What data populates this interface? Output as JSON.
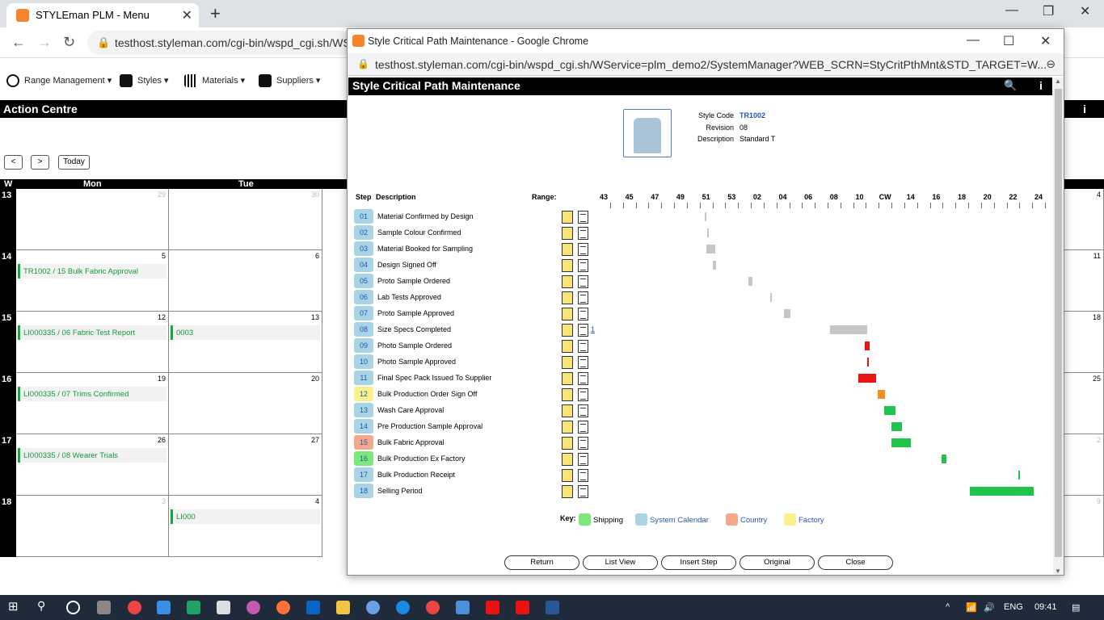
{
  "browser": {
    "tab_title": "STYLEman PLM - Menu",
    "url": "testhost.styleman.com/cgi-bin/wspd_cgi.sh/WS"
  },
  "menu": {
    "items": [
      "Range Management",
      "Styles",
      "Materials",
      "Suppliers"
    ]
  },
  "action_centre": {
    "title": "Action Centre",
    "info": "i"
  },
  "calendar": {
    "today_label": "Today",
    "col_w": "W",
    "col_mon": "Mon",
    "col_tue": "Tue",
    "weeks": [
      {
        "wk": "13",
        "mon": "29",
        "tue": "30",
        "right": "4",
        "mon_grey": true,
        "tue_grey": true,
        "right_grey": false
      },
      {
        "wk": "14",
        "mon": "5",
        "tue": "6",
        "right": "11",
        "mon_grey": false,
        "tue_grey": false,
        "right_grey": false
      },
      {
        "wk": "15",
        "mon": "12",
        "tue": "13",
        "right": "18",
        "mon_grey": false,
        "tue_grey": false,
        "right_grey": false
      },
      {
        "wk": "16",
        "mon": "19",
        "tue": "20",
        "right": "25",
        "mon_grey": false,
        "tue_grey": false,
        "right_grey": false
      },
      {
        "wk": "17",
        "mon": "26",
        "tue": "27",
        "right": "2",
        "mon_grey": false,
        "tue_grey": false,
        "right_grey": true
      },
      {
        "wk": "18",
        "mon": "3",
        "tue": "4",
        "right": "9",
        "mon_grey": true,
        "tue_grey": false,
        "right_grey": true
      }
    ],
    "events": [
      {
        "text": "TR1002 / 15 Bulk Fabric Approval"
      },
      {
        "text": "LI000335 / 06 Fabric Test Report"
      },
      {
        "text": "0003"
      },
      {
        "text": "LI000335 / 07 Trims Confirmed"
      },
      {
        "text": "LI000335 / 08 Wearer Trials"
      },
      {
        "text": "LI000"
      }
    ]
  },
  "popup": {
    "window_title": "Style Critical Path Maintenance - Google Chrome",
    "url": "testhost.styleman.com/cgi-bin/wspd_cgi.sh/WService=plm_demo2/SystemManager?WEB_SCRN=StyCritPthMnt&STD_TARGET=W...",
    "header": "Style Critical Path Maintenance",
    "info": "i",
    "style": {
      "code_label": "Style Code",
      "code": "TR1002",
      "revision_label": "Revision",
      "revision": "08",
      "description_label": "Description",
      "description": "Standard T"
    },
    "col_step": "Step",
    "col_description": "Description",
    "col_range": "Range:",
    "timeline_labels": [
      "43",
      "45",
      "47",
      "49",
      "51",
      "53",
      "02",
      "04",
      "06",
      "08",
      "10",
      "CW",
      "14",
      "16",
      "18",
      "20",
      "22",
      "24"
    ],
    "steps": [
      {
        "num": "01",
        "desc": "Material Confirmed by Design",
        "type": "system"
      },
      {
        "num": "02",
        "desc": "Sample Colour Confirmed",
        "type": "system"
      },
      {
        "num": "03",
        "desc": "Material Booked for Sampling",
        "type": "system"
      },
      {
        "num": "04",
        "desc": "Design Signed Off",
        "type": "system"
      },
      {
        "num": "05",
        "desc": "Proto Sample Ordered",
        "type": "system"
      },
      {
        "num": "06",
        "desc": "Lab Tests Approved",
        "type": "system"
      },
      {
        "num": "07",
        "desc": "Proto Sample Approved",
        "type": "system"
      },
      {
        "num": "08",
        "desc": "Size Specs Completed",
        "type": "system",
        "link": "1"
      },
      {
        "num": "09",
        "desc": "Photo Sample Ordered",
        "type": "system"
      },
      {
        "num": "10",
        "desc": "Photo Sample Approved",
        "type": "system"
      },
      {
        "num": "11",
        "desc": "Final Spec Pack Issued To Supplier",
        "type": "system"
      },
      {
        "num": "12",
        "desc": "Bulk Production Order Sign Off",
        "type": "factory"
      },
      {
        "num": "13",
        "desc": "Wash Care Approval",
        "type": "system"
      },
      {
        "num": "14",
        "desc": "Pre Production Sample Approval",
        "type": "system"
      },
      {
        "num": "15",
        "desc": "Bulk Fabric Approval",
        "type": "country"
      },
      {
        "num": "16",
        "desc": "Bulk Production Ex Factory",
        "type": "shipping"
      },
      {
        "num": "17",
        "desc": "Bulk Production Receipt",
        "type": "system"
      },
      {
        "num": "18",
        "desc": "Selling Period",
        "type": "system"
      }
    ],
    "bars": [
      {
        "start": 50.9,
        "end": 51.0,
        "status": "grey"
      },
      {
        "start": 51.1,
        "end": 51.2,
        "status": "grey"
      },
      {
        "start": 51.0,
        "end": 51.7,
        "status": "grey"
      },
      {
        "start": 51.5,
        "end": 51.8,
        "status": "grey"
      },
      {
        "start": 54.3,
        "end": 54.6,
        "status": "grey"
      },
      {
        "start": 56.0,
        "end": 56.1,
        "status": "grey"
      },
      {
        "start": 57.1,
        "end": 57.6,
        "status": "grey"
      },
      {
        "start": 60.7,
        "end": 63.6,
        "status": "grey"
      },
      {
        "start": 63.4,
        "end": 63.8,
        "status": "red"
      },
      {
        "start": 63.6,
        "end": 63.7,
        "status": "red"
      },
      {
        "start": 62.9,
        "end": 64.3,
        "status": "red"
      },
      {
        "start": 64.4,
        "end": 65.0,
        "status": "orange"
      },
      {
        "start": 64.9,
        "end": 65.8,
        "status": "green"
      },
      {
        "start": 65.5,
        "end": 66.3,
        "status": "green"
      },
      {
        "start": 65.5,
        "end": 67.0,
        "status": "green"
      },
      {
        "start": 69.4,
        "end": 69.8,
        "status": "green"
      },
      {
        "start": 75.4,
        "end": 75.5,
        "status": "green"
      },
      {
        "start": 71.6,
        "end": 76.6,
        "status": "green"
      }
    ],
    "key_label": "Key:",
    "key": [
      {
        "label": "Shipping",
        "color": "#7de87a"
      },
      {
        "label": "System Calendar",
        "color": "#a8d4e6"
      },
      {
        "label": "Country",
        "color": "#f4a98c"
      },
      {
        "label": "Factory",
        "color": "#f8f08a"
      }
    ],
    "buttons": [
      "Return",
      "List View",
      "Insert Step",
      "Original",
      "Close"
    ]
  },
  "colors": {
    "grey": "#c6c6c6",
    "red": "#ea1414",
    "orange": "#f0901e",
    "green": "#20c44b"
  },
  "taskbar": {
    "lang": "ENG",
    "time": "09:41"
  }
}
